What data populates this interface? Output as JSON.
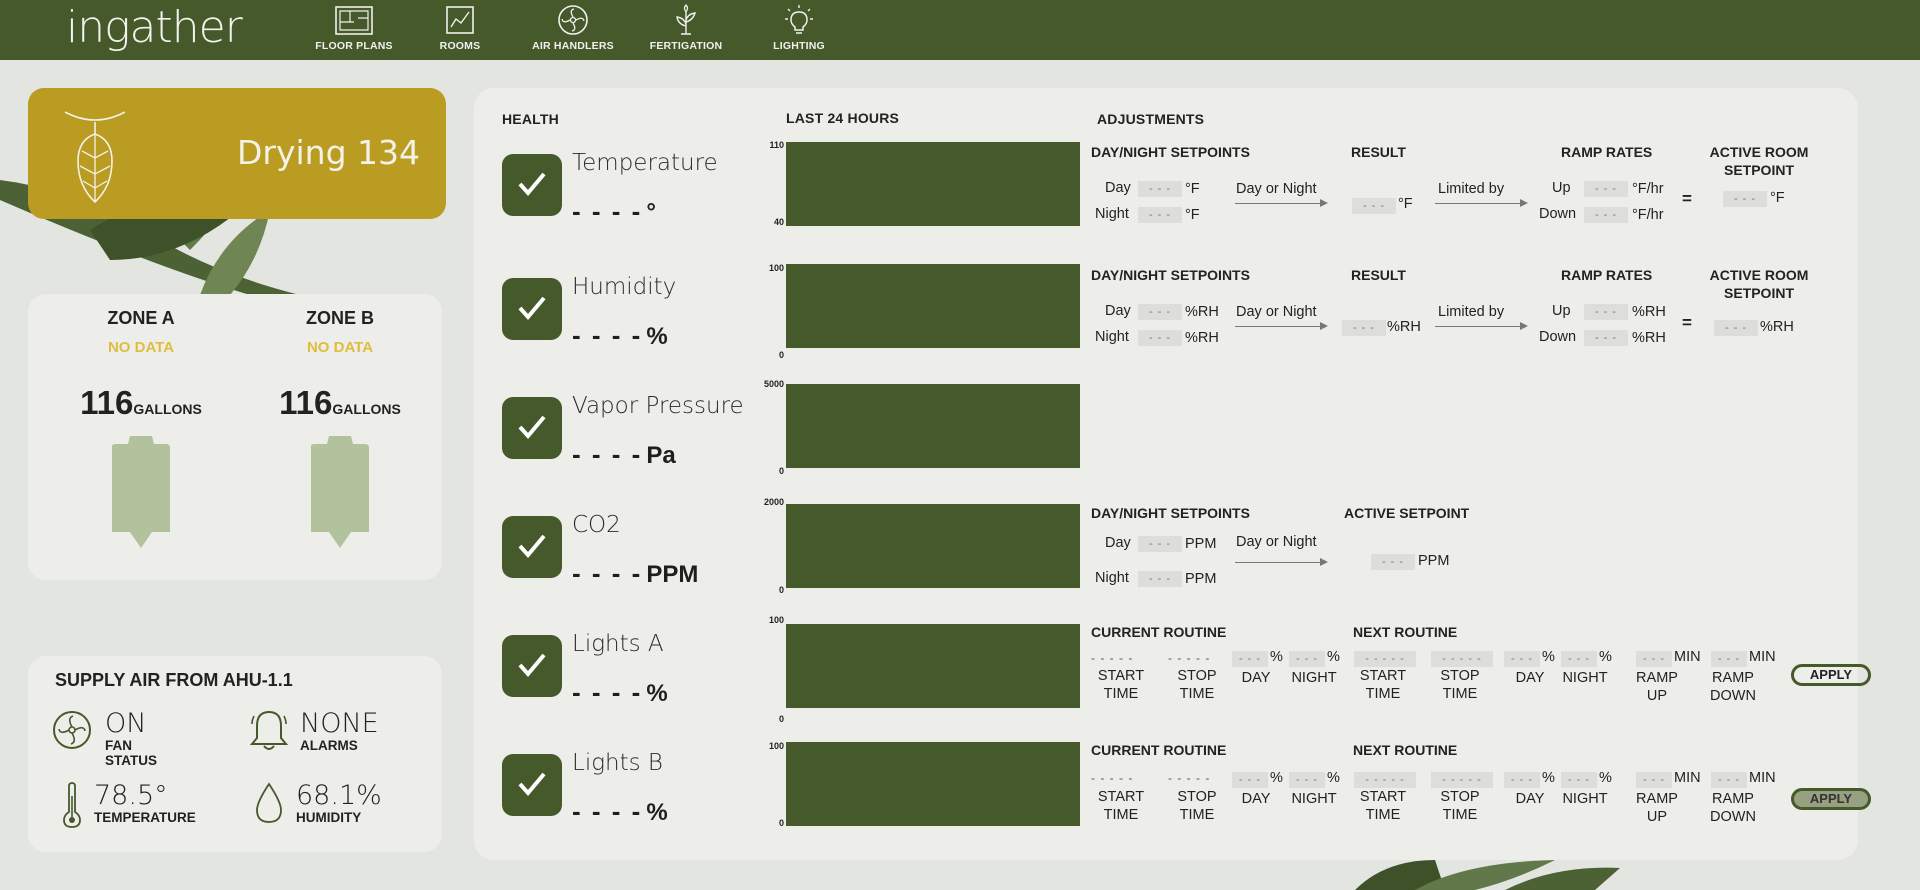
{
  "nav": {
    "logo": "ingather",
    "items": [
      {
        "label": "FLOOR PLANS",
        "icon": "floor-plan-icon"
      },
      {
        "label": "ROOMS",
        "icon": "rooms-chart-icon"
      },
      {
        "label": "AIR HANDLERS",
        "icon": "fan-icon"
      },
      {
        "label": "FERTIGATION",
        "icon": "plant-icon"
      },
      {
        "label": "LIGHTING",
        "icon": "lightbulb-icon"
      }
    ]
  },
  "room": {
    "title": "Drying 134",
    "icon": "hops-icon",
    "color": "#b99c21"
  },
  "zones": [
    {
      "name": "ZONE A",
      "status": "NO DATA",
      "gallons": "116",
      "unit": "GALLONS"
    },
    {
      "name": "ZONE B",
      "status": "NO DATA",
      "gallons": "116",
      "unit": "GALLONS"
    }
  ],
  "supply": {
    "title": "SUPPLY AIR FROM AHU-1.1",
    "fan": {
      "value": "ON",
      "label": "FAN STATUS"
    },
    "alarms": {
      "value": "NONE",
      "label": "ALARMS"
    },
    "temperature": {
      "value": "78.5°",
      "label": "TEMPERATURE"
    },
    "humidity": {
      "value": "68.1%",
      "label": "HUMIDITY"
    }
  },
  "headers": {
    "health": "HEALTH",
    "last24": "LAST 24 HOURS",
    "adjustments": "ADJUSTMENTS"
  },
  "metrics": [
    {
      "name": "Temperature",
      "value": "- - - -",
      "unit": "°",
      "ymax": "110",
      "ymin": "40"
    },
    {
      "name": "Humidity",
      "value": "- - - -",
      "unit": "%",
      "ymax": "100",
      "ymin": "0"
    },
    {
      "name": "Vapor Pressure",
      "value": "- - - -",
      "unit": "Pa",
      "ymax": "5000",
      "ymin": "0"
    },
    {
      "name": "CO2",
      "value": "- - - -",
      "unit": "PPM",
      "ymax": "2000",
      "ymin": "0"
    },
    {
      "name": "Lights A",
      "value": "- - - -",
      "unit": "%",
      "ymax": "100",
      "ymin": "0"
    },
    {
      "name": "Lights B",
      "value": "- - - -",
      "unit": "%",
      "ymax": "100",
      "ymin": "0"
    }
  ],
  "labels": {
    "dn_setpoints": "DAY/NIGHT SETPOINTS",
    "result": "RESULT",
    "ramp_rates": "RAMP RATES",
    "active_room_setpoint_1": "ACTIVE ROOM",
    "active_room_setpoint_2": "SETPOINT",
    "active_setpoint": "ACTIVE SETPOINT",
    "day": "Day",
    "night": "Night",
    "day_or_night": "Day or Night",
    "limited_by": "Limited by",
    "up": "Up",
    "down": "Down",
    "equals": "=",
    "blank": "- - -",
    "blank5": "- - - - -",
    "current_routine": "CURRENT ROUTINE",
    "next_routine": "NEXT ROUTINE",
    "start_1": "START",
    "start_2": "TIME",
    "stop_1": "STOP",
    "stop_2": "TIME",
    "day_caps": "DAY",
    "night_caps": "NIGHT",
    "ramp_1": "RAMP",
    "ramp_up": "UP",
    "ramp_down": "DOWN",
    "min": "MIN",
    "pct": "%",
    "apply": "APPLY"
  },
  "units": {
    "degf": "°F",
    "degf_hr": "°F/hr",
    "rh": "%RH",
    "ppm": "PPM"
  }
}
